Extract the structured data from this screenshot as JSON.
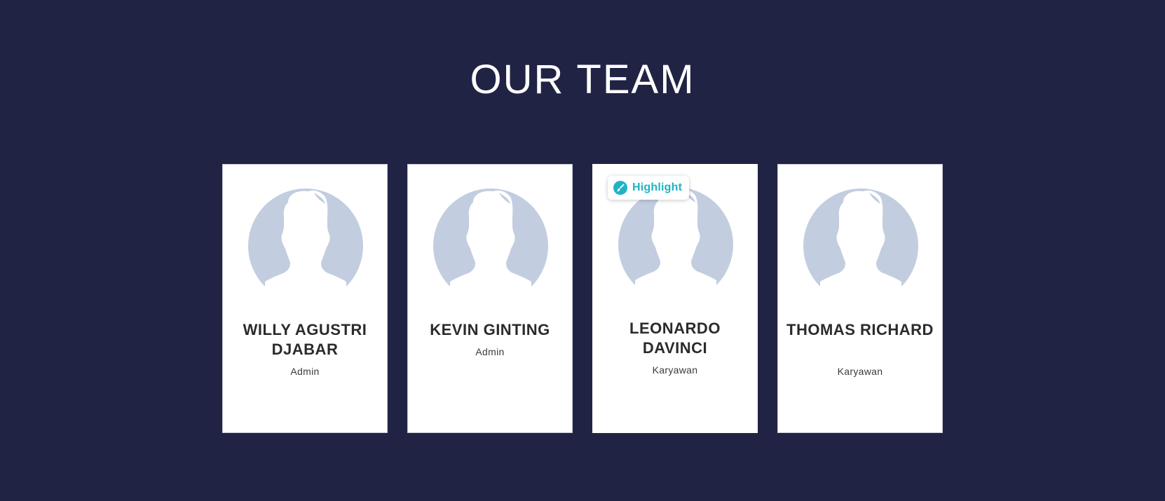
{
  "section": {
    "title": "OUR TEAM"
  },
  "team": [
    {
      "name": "WILLY AGUSTRI DJABAR",
      "role": "Admin"
    },
    {
      "name": "KEVIN GINTING",
      "role": "Admin"
    },
    {
      "name": "LEONARDO DAVINCI",
      "role": "Karyawan"
    },
    {
      "name": "THOMAS RICHARD",
      "role": "Karyawan"
    }
  ],
  "highlight_badge": {
    "label": "Highlight",
    "icon": "brush-icon",
    "color": "#1fb3c4"
  },
  "colors": {
    "page_background": "#212345",
    "card_background": "#ffffff",
    "avatar_fill": "#c3cde0"
  }
}
